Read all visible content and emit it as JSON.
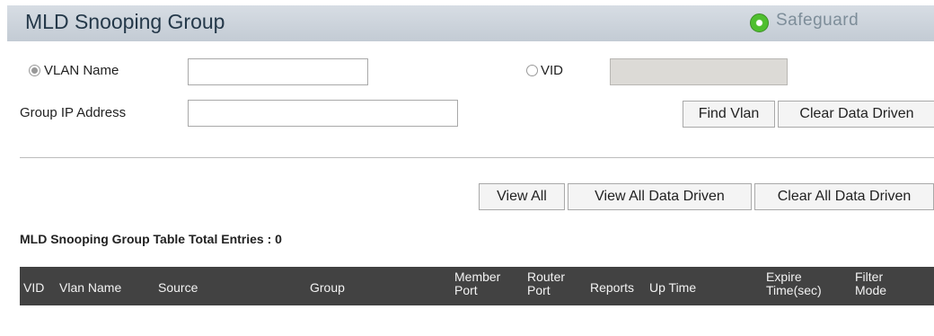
{
  "header": {
    "title": "MLD Snooping Group",
    "safeguard_label": "Safeguard",
    "safeguard_status_color": "#4fbf2f"
  },
  "form": {
    "vlan_name_label": "VLAN Name",
    "vlan_name_value": "",
    "vid_label": "VID",
    "vid_value": "",
    "group_ip_label": "Group IP Address",
    "group_ip_value": "",
    "selected_radio": "VLAN Name"
  },
  "buttons": {
    "find_vlan": "Find Vlan",
    "clear_data_driven": "Clear Data Driven",
    "view_all": "View All",
    "view_all_data_driven": "View All Data Driven",
    "clear_all_data_driven": "Clear All Data Driven"
  },
  "table": {
    "total_label": "MLD Snooping Group Table Total Entries :",
    "total_value": "0",
    "columns": [
      "VID",
      "Vlan Name",
      "Source",
      "Group",
      "Member Port",
      "Router Port",
      "Reports",
      "Up Time",
      "Expire Time(sec)",
      "Filter Mode"
    ],
    "rows": []
  }
}
